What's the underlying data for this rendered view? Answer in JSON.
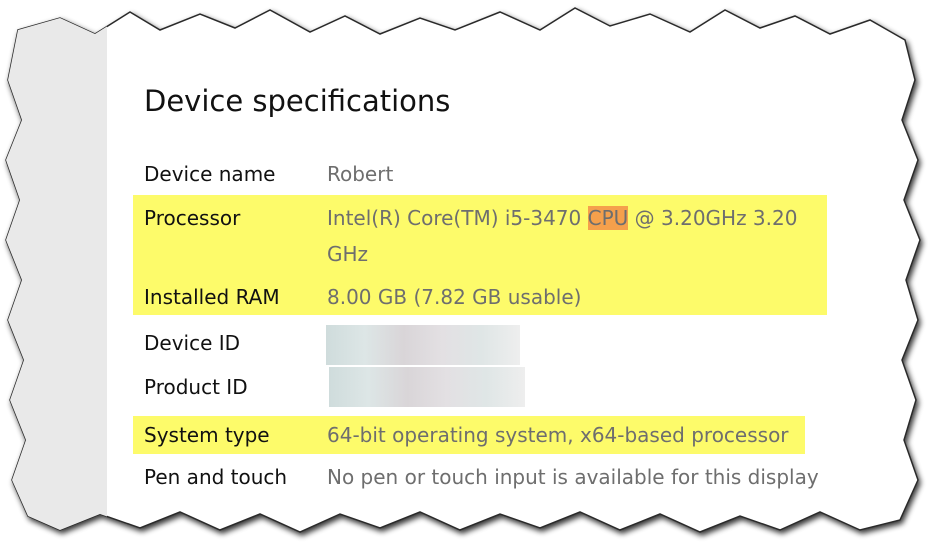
{
  "section": {
    "title": "Device specifications"
  },
  "specs": {
    "device_name": {
      "label": "Device name",
      "value": "Robert"
    },
    "processor": {
      "label": "Processor",
      "value_pre": "Intel(R) Core(TM) i5-3470 ",
      "value_highlight": "CPU",
      "value_post": " @ 3.20GHz   3.20",
      "value_line2": "GHz"
    },
    "installed_ram": {
      "label": "Installed RAM",
      "value": "8.00 GB (7.82 GB usable)"
    },
    "device_id": {
      "label": "Device ID",
      "value": ""
    },
    "product_id": {
      "label": "Product ID",
      "value": ""
    },
    "system_type": {
      "label": "System type",
      "value": "64-bit operating system, x64-based processor"
    },
    "pen_and_touch": {
      "label": "Pen and touch",
      "value": "No pen or touch input is available for this display"
    }
  },
  "colors": {
    "highlight_yellow": "#fdfb6a",
    "highlight_orange": "#f5a04c",
    "label_text": "#111111",
    "value_text": "#6e6e6e",
    "left_panel": "#e9e9e9",
    "redaction": "#cfd9da"
  }
}
